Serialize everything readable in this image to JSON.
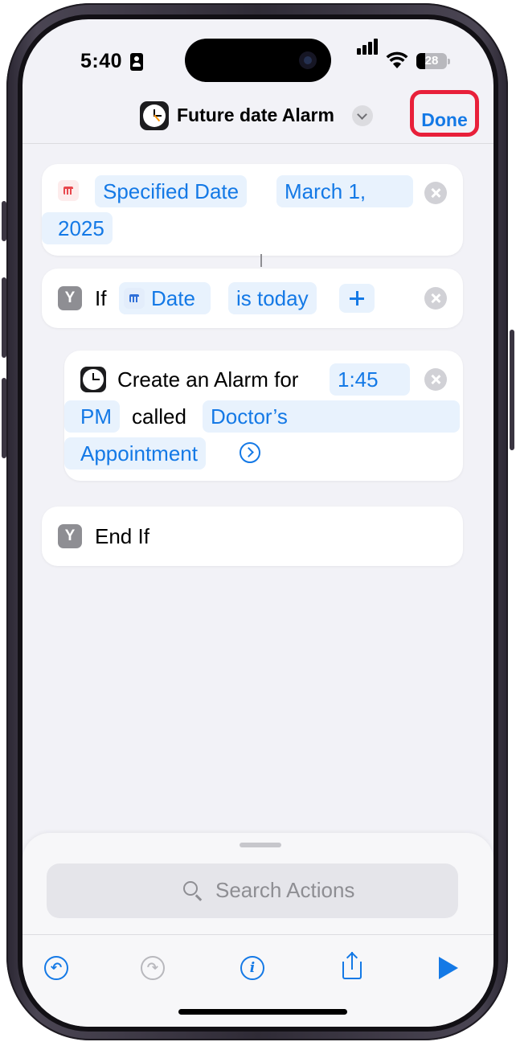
{
  "status_bar": {
    "time": "5:40",
    "battery_level": "28"
  },
  "nav": {
    "title": "Future date Alarm",
    "done_label": "Done"
  },
  "actions": {
    "date_action": {
      "token_label": "Specified Date",
      "date_value_line1": "March 1,",
      "date_value_line2": "2025"
    },
    "if_action": {
      "keyword": "If",
      "variable_label": "Date",
      "condition_label": "is today"
    },
    "alarm_action": {
      "prefix": "Create an Alarm for",
      "time_line1": "1:45",
      "time_line2": "PM",
      "connector": "called",
      "name_line1": "Doctor’s",
      "name_line2": "Appointment"
    },
    "end_if": {
      "label": "End If"
    }
  },
  "bottom_sheet": {
    "search_placeholder": "Search Actions"
  },
  "icons": {
    "undo": "undo-icon",
    "redo": "redo-icon",
    "info": "info-icon",
    "share": "share-icon",
    "play": "play-icon"
  },
  "colors": {
    "accent": "#1479e6",
    "highlight": "#e8203a",
    "token_bg": "#e8f2fd"
  }
}
